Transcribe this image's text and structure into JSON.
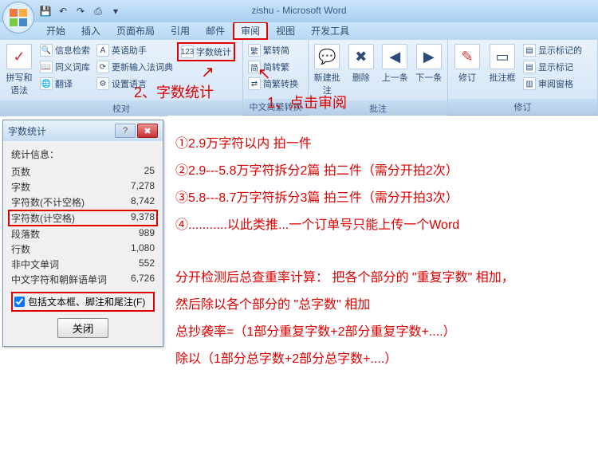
{
  "title": "zishu - Microsoft Word",
  "qat": {
    "save": "💾",
    "undo": "↶",
    "redo": "↷",
    "print": "⎙",
    "more": "▾"
  },
  "tabs": [
    "开始",
    "插入",
    "页面布局",
    "引用",
    "邮件",
    "审阅",
    "视图",
    "开发工具"
  ],
  "active_tab_index": 5,
  "ribbon": {
    "group1": {
      "big": {
        "label": "拼写和\n语法",
        "icon": "字A"
      },
      "items": [
        "信息检索",
        "同义词库",
        "翻译"
      ],
      "items2": [
        "英语助手",
        "更新输入法词典",
        "设置语言"
      ],
      "label": "校对",
      "wordcount": "字数统计"
    },
    "group2": {
      "items": [
        "繁转简",
        "简转繁",
        "简繁转换"
      ],
      "label": "中文简繁转换"
    },
    "group3": {
      "btns": [
        "新建批注",
        "删除",
        "上一条",
        "下一条"
      ],
      "label": "批注"
    },
    "group4": {
      "btns": [
        "修订",
        "批注框"
      ],
      "items": [
        "显示标记的",
        "显示标记",
        "审阅窗格"
      ],
      "label": "修订"
    }
  },
  "annotations": {
    "a1": "1、点击审阅",
    "a2": "2、字数统计"
  },
  "dialog": {
    "title": "字数统计",
    "stats_label": "统计信息：",
    "rows": [
      {
        "k": "页数",
        "v": "25"
      },
      {
        "k": "字数",
        "v": "7,278"
      },
      {
        "k": "字符数(不计空格)",
        "v": "8,742"
      },
      {
        "k": "字符数(计空格)",
        "v": "9,378",
        "hl": true
      },
      {
        "k": "段落数",
        "v": "989"
      },
      {
        "k": "行数",
        "v": "1,080"
      },
      {
        "k": "非中文单词",
        "v": "552"
      },
      {
        "k": "中文字符和朝鲜语单词",
        "v": "6,726"
      }
    ],
    "checkbox": "包括文本框、脚注和尾注(F)",
    "close_btn": "关闭"
  },
  "doc": {
    "l1": "①2.9万字符以内 拍一件",
    "l2": "②2.9---5.8万字符拆分2篇 拍二件（需分开拍2次）",
    "l3": "③5.8---8.7万字符拆分3篇 拍三件（需分开拍3次）",
    "l4": "④...........以此类推...一个订单号只能上传一个Word",
    "l5": "分开检测后总查重率计算： 把各个部分的 \"重复字数\" 相加，",
    "l6": "然后除以各个部分的 \"总字数\" 相加",
    "l7": "总抄袭率=（1部分重复字数+2部分重复字数+....）",
    "l8": "除以（1部分总字数+2部分总字数+....）"
  }
}
